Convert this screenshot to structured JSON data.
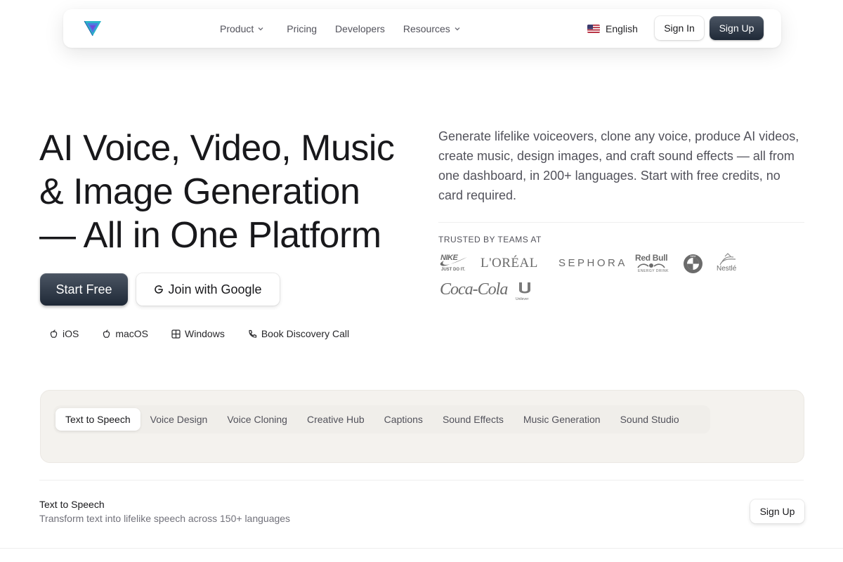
{
  "nav": {
    "links": [
      {
        "label": "Product",
        "dropdown": true
      },
      {
        "label": "Pricing",
        "dropdown": false
      },
      {
        "label": "Developers",
        "dropdown": false
      },
      {
        "label": "Resources",
        "dropdown": true
      }
    ],
    "language": "English",
    "language_flag": "us-flag-icon",
    "signin_label": "Sign In",
    "signup_label": "Sign Up"
  },
  "hero": {
    "title_lines": [
      "AI Voice, Video, Music",
      "& Image Generation",
      "— All in One Platform"
    ],
    "start_label": "Start Free",
    "google_label": "Join with Google",
    "platforms": [
      {
        "label": "iOS",
        "icon": "apple-icon"
      },
      {
        "label": "macOS",
        "icon": "apple-icon"
      },
      {
        "label": "Windows",
        "icon": "windows-icon"
      },
      {
        "label": "Book Discovery Call",
        "icon": "phone-icon"
      }
    ],
    "description": "Generate lifelike voiceovers, clone any voice, produce AI videos, create music, design images, and craft sound effects — all from one dashboard, in 200+ languages. Start with free credits, no card required.",
    "trusted_label": "TRUSTED BY TEAMS AT",
    "brands": [
      "NIKE",
      "JUST DO IT.",
      "L'ORÉAL",
      "SEPHORA",
      "Red Bull",
      "ENERGY DRINK",
      "BMW",
      "Nestlé",
      "Coca-Cola",
      "Unilever"
    ]
  },
  "tabs": {
    "items": [
      "Text to Speech",
      "Voice Design",
      "Voice Cloning",
      "Creative Hub",
      "Captions",
      "Sound Effects",
      "Music Generation",
      "Sound Studio"
    ],
    "active_index": 0
  },
  "feature": {
    "title": "Text to Speech",
    "subtitle": "Transform text into lifelike speech across 150+ languages",
    "signup_label": "Sign Up"
  },
  "colors": {
    "primary_dark": "#1f2937",
    "panel_bg": "#f4f2ee",
    "logo_teal": "#2bb5c9",
    "logo_purple": "#6d4bd8"
  }
}
